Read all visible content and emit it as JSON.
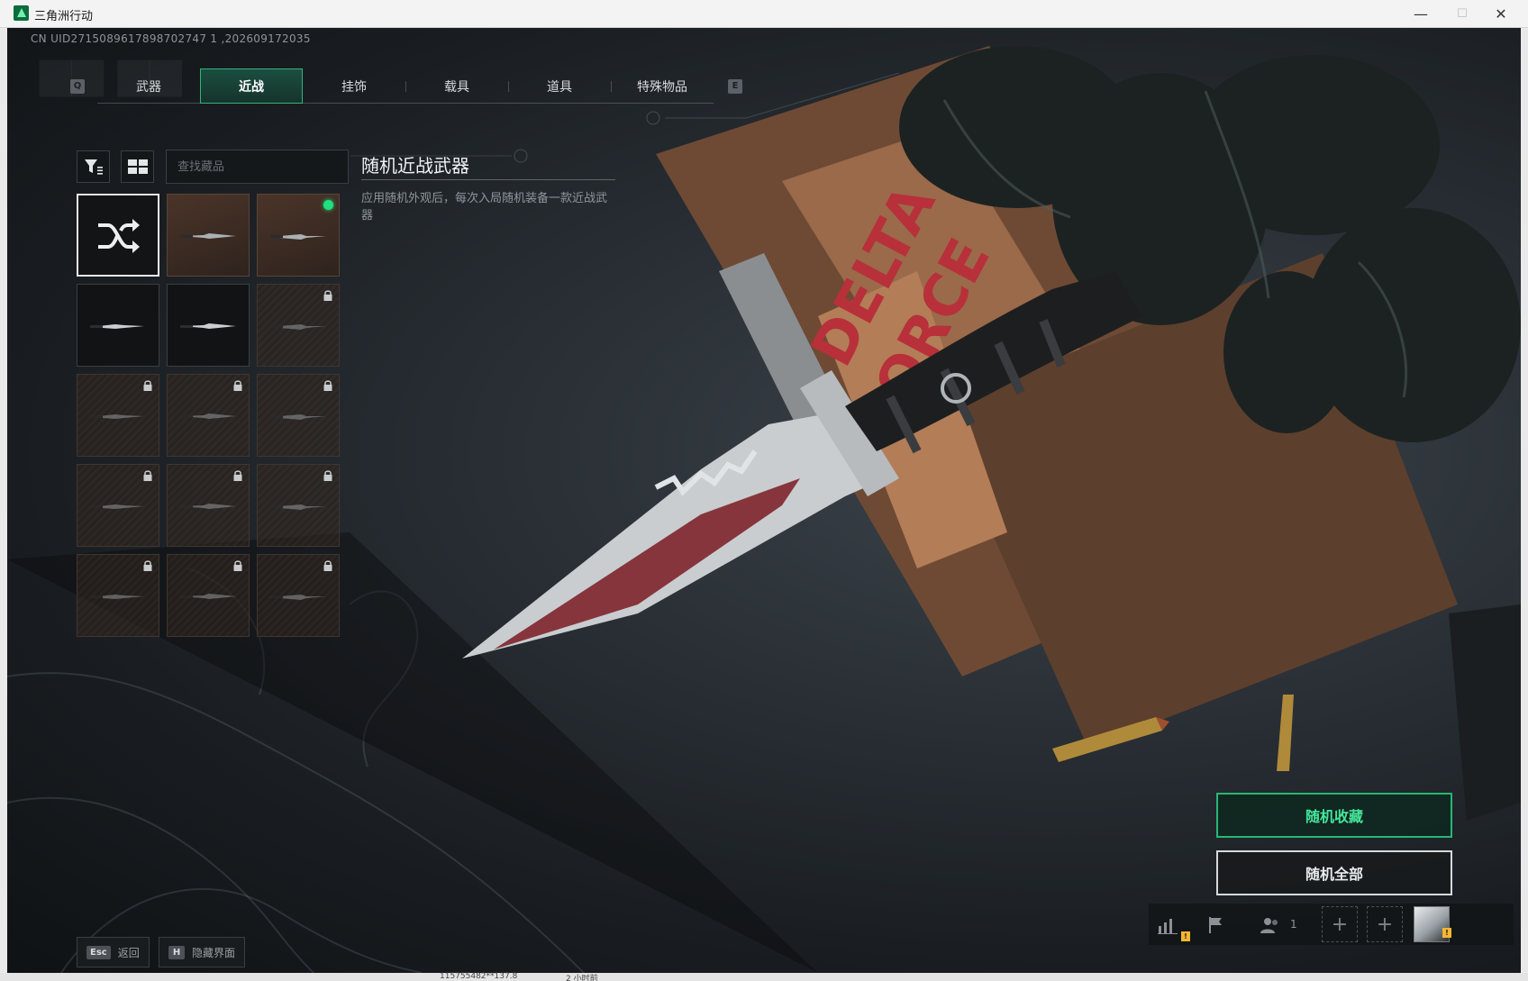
{
  "window": {
    "title": "三角洲行动",
    "minimize_glyph": "—",
    "maximize_glyph": "☐",
    "close_glyph": "✕"
  },
  "uid_text": "CN UID2715089617898702747 1 ,202609172035",
  "tabs": {
    "prev_key": "Q",
    "next_key": "E",
    "items": [
      {
        "label": "武器"
      },
      {
        "label": "近战",
        "active": true
      },
      {
        "label": "挂饰"
      },
      {
        "label": "载具"
      },
      {
        "label": "道具"
      },
      {
        "label": "特殊物品"
      }
    ]
  },
  "search": {
    "placeholder": "查找藏品",
    "value": ""
  },
  "toolbar_icons": [
    "filter-icon",
    "grid-view-icon"
  ],
  "items": [
    {
      "type": "random",
      "icon": "shuffle-icon",
      "selected": true,
      "locked": false
    },
    {
      "type": "knife",
      "style": "brown",
      "locked": false
    },
    {
      "type": "knife",
      "style": "brown",
      "locked": false,
      "equipped": true
    },
    {
      "type": "knife",
      "style": "dark",
      "locked": false
    },
    {
      "type": "knife",
      "style": "dark",
      "locked": false
    },
    {
      "type": "knife",
      "style": "locked",
      "locked": true
    },
    {
      "type": "knife",
      "style": "locked",
      "locked": true
    },
    {
      "type": "knife",
      "style": "locked",
      "locked": true
    },
    {
      "type": "knife",
      "style": "locked",
      "locked": true
    },
    {
      "type": "knife",
      "style": "locked",
      "locked": true
    },
    {
      "type": "knife",
      "style": "locked",
      "locked": true
    },
    {
      "type": "knife",
      "style": "locked",
      "locked": true
    },
    {
      "type": "knife",
      "style": "locked",
      "locked": true
    },
    {
      "type": "knife",
      "style": "locked",
      "locked": true
    },
    {
      "type": "knife",
      "style": "locked",
      "locked": true
    }
  ],
  "info": {
    "title": "随机近战武器",
    "description": "应用随机外观后，每次入局随机装备一款近战武器"
  },
  "actions": {
    "primary": "随机收藏",
    "secondary": "随机全部"
  },
  "hints": [
    {
      "key": "Esc",
      "label": "返回"
    },
    {
      "key": "H",
      "label": "隐藏界面"
    }
  ],
  "bottom_bar": {
    "stats_badge": "!",
    "party_count": "1",
    "avatar_badge": "!"
  },
  "taskbar": {
    "text_a": "115755482**137.8",
    "text_b": "2 小时前"
  },
  "colors": {
    "accent_green": "#27b776",
    "equipped_dot": "#20e07f",
    "badge_yellow": "#f2b632"
  }
}
